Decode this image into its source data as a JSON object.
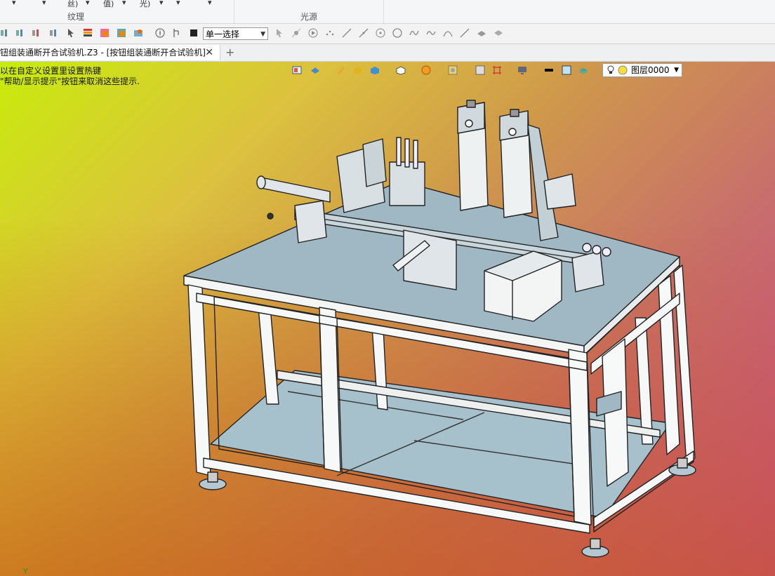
{
  "ribbon": {
    "row_texts": [
      "▾",
      "▾",
      "丝)",
      "▾",
      "值)",
      "▾",
      "光)",
      "▾",
      "▾",
      "▾"
    ],
    "groups": [
      "纹理",
      "光源"
    ]
  },
  "toolbar": {
    "select_value": "单一选择",
    "icons": [
      "filter-icon",
      "filter-icon",
      "filter-icon",
      "filter-icon",
      "pick-icon",
      "list-icon",
      "image-icon",
      "image-icon",
      "image-icon",
      "compass-icon",
      "tree-icon",
      "square-icon",
      "arrow-icon",
      "point-icon",
      "play-icon",
      "points-icon",
      "line-icon",
      "line-icon",
      "circle-dot-icon",
      "circle-icon",
      "spline-icon",
      "curve-icon",
      "arc-icon",
      "pen-icon",
      "curve-tool-icon",
      "surface-icon"
    ]
  },
  "tabs": {
    "active_title": "钮组装通断开合试验机.Z3 - [按钮组装通断开合试验机]",
    "close_glyph": "✕",
    "new_tab_glyph": "+"
  },
  "viewport": {
    "hint_lines": [
      "以在自定义设置里设置热键",
      "\"帮助/显示提示\"按钮来取消这些提示."
    ],
    "layer_value": "图层0000",
    "axis_label": "Y",
    "colors": {
      "frame": "#f7f8f8",
      "plate": "#9fb8c4",
      "outline": "#222222"
    }
  }
}
